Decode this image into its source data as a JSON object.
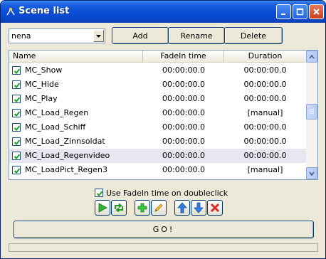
{
  "window": {
    "title": "Scene list",
    "controls": [
      "minimize-icon",
      "maximize-icon",
      "close-icon"
    ]
  },
  "toolbar": {
    "list_select_value": "nena",
    "add_label": "Add",
    "rename_label": "Rename",
    "delete_label": "Delete"
  },
  "table": {
    "columns": [
      "Name",
      "FadeIn time",
      "Duration"
    ],
    "rows": [
      {
        "checked": true,
        "name": "MC_Show",
        "fadein": "00:00:00.0",
        "duration": "00:00:00.0"
      },
      {
        "checked": true,
        "name": "MC_Hide",
        "fadein": "00:00:00.0",
        "duration": "00:00:00.0"
      },
      {
        "checked": true,
        "name": "MC_Play",
        "fadein": "00:00:00.0",
        "duration": "00:00:00.0"
      },
      {
        "checked": true,
        "name": "MC_Load_Regen",
        "fadein": "00:00:00.0",
        "duration": "[manual]"
      },
      {
        "checked": true,
        "name": "MC_Load_Schiff",
        "fadein": "00:00:00.0",
        "duration": "00:00:00.0"
      },
      {
        "checked": true,
        "name": "MC_Load_Zinnsoldat",
        "fadein": "00:00:00.0",
        "duration": "00:00:00.0"
      },
      {
        "checked": true,
        "name": "MC_Load_Regenvideo",
        "fadein": "00:00:00.0",
        "duration": "00:00:00.0",
        "selected": true
      },
      {
        "checked": true,
        "name": "MC_LoadPict_Regen3",
        "fadein": "00:00:00.0",
        "duration": "[manual]"
      }
    ]
  },
  "options": {
    "fadein_doubleclick_label": "Use FadeIn time on doubleclick",
    "fadein_doubleclick_checked": true
  },
  "tools": [
    "play-icon",
    "swap-icon",
    "add-icon",
    "edit-icon",
    "move-up-icon",
    "move-down-icon",
    "remove-icon"
  ],
  "go_label": "GO!",
  "colors": {
    "titlebar": "#0a4fd8",
    "face": "#ece9d8",
    "selected_row": "#e8e6f0",
    "close": "#c6401e"
  }
}
